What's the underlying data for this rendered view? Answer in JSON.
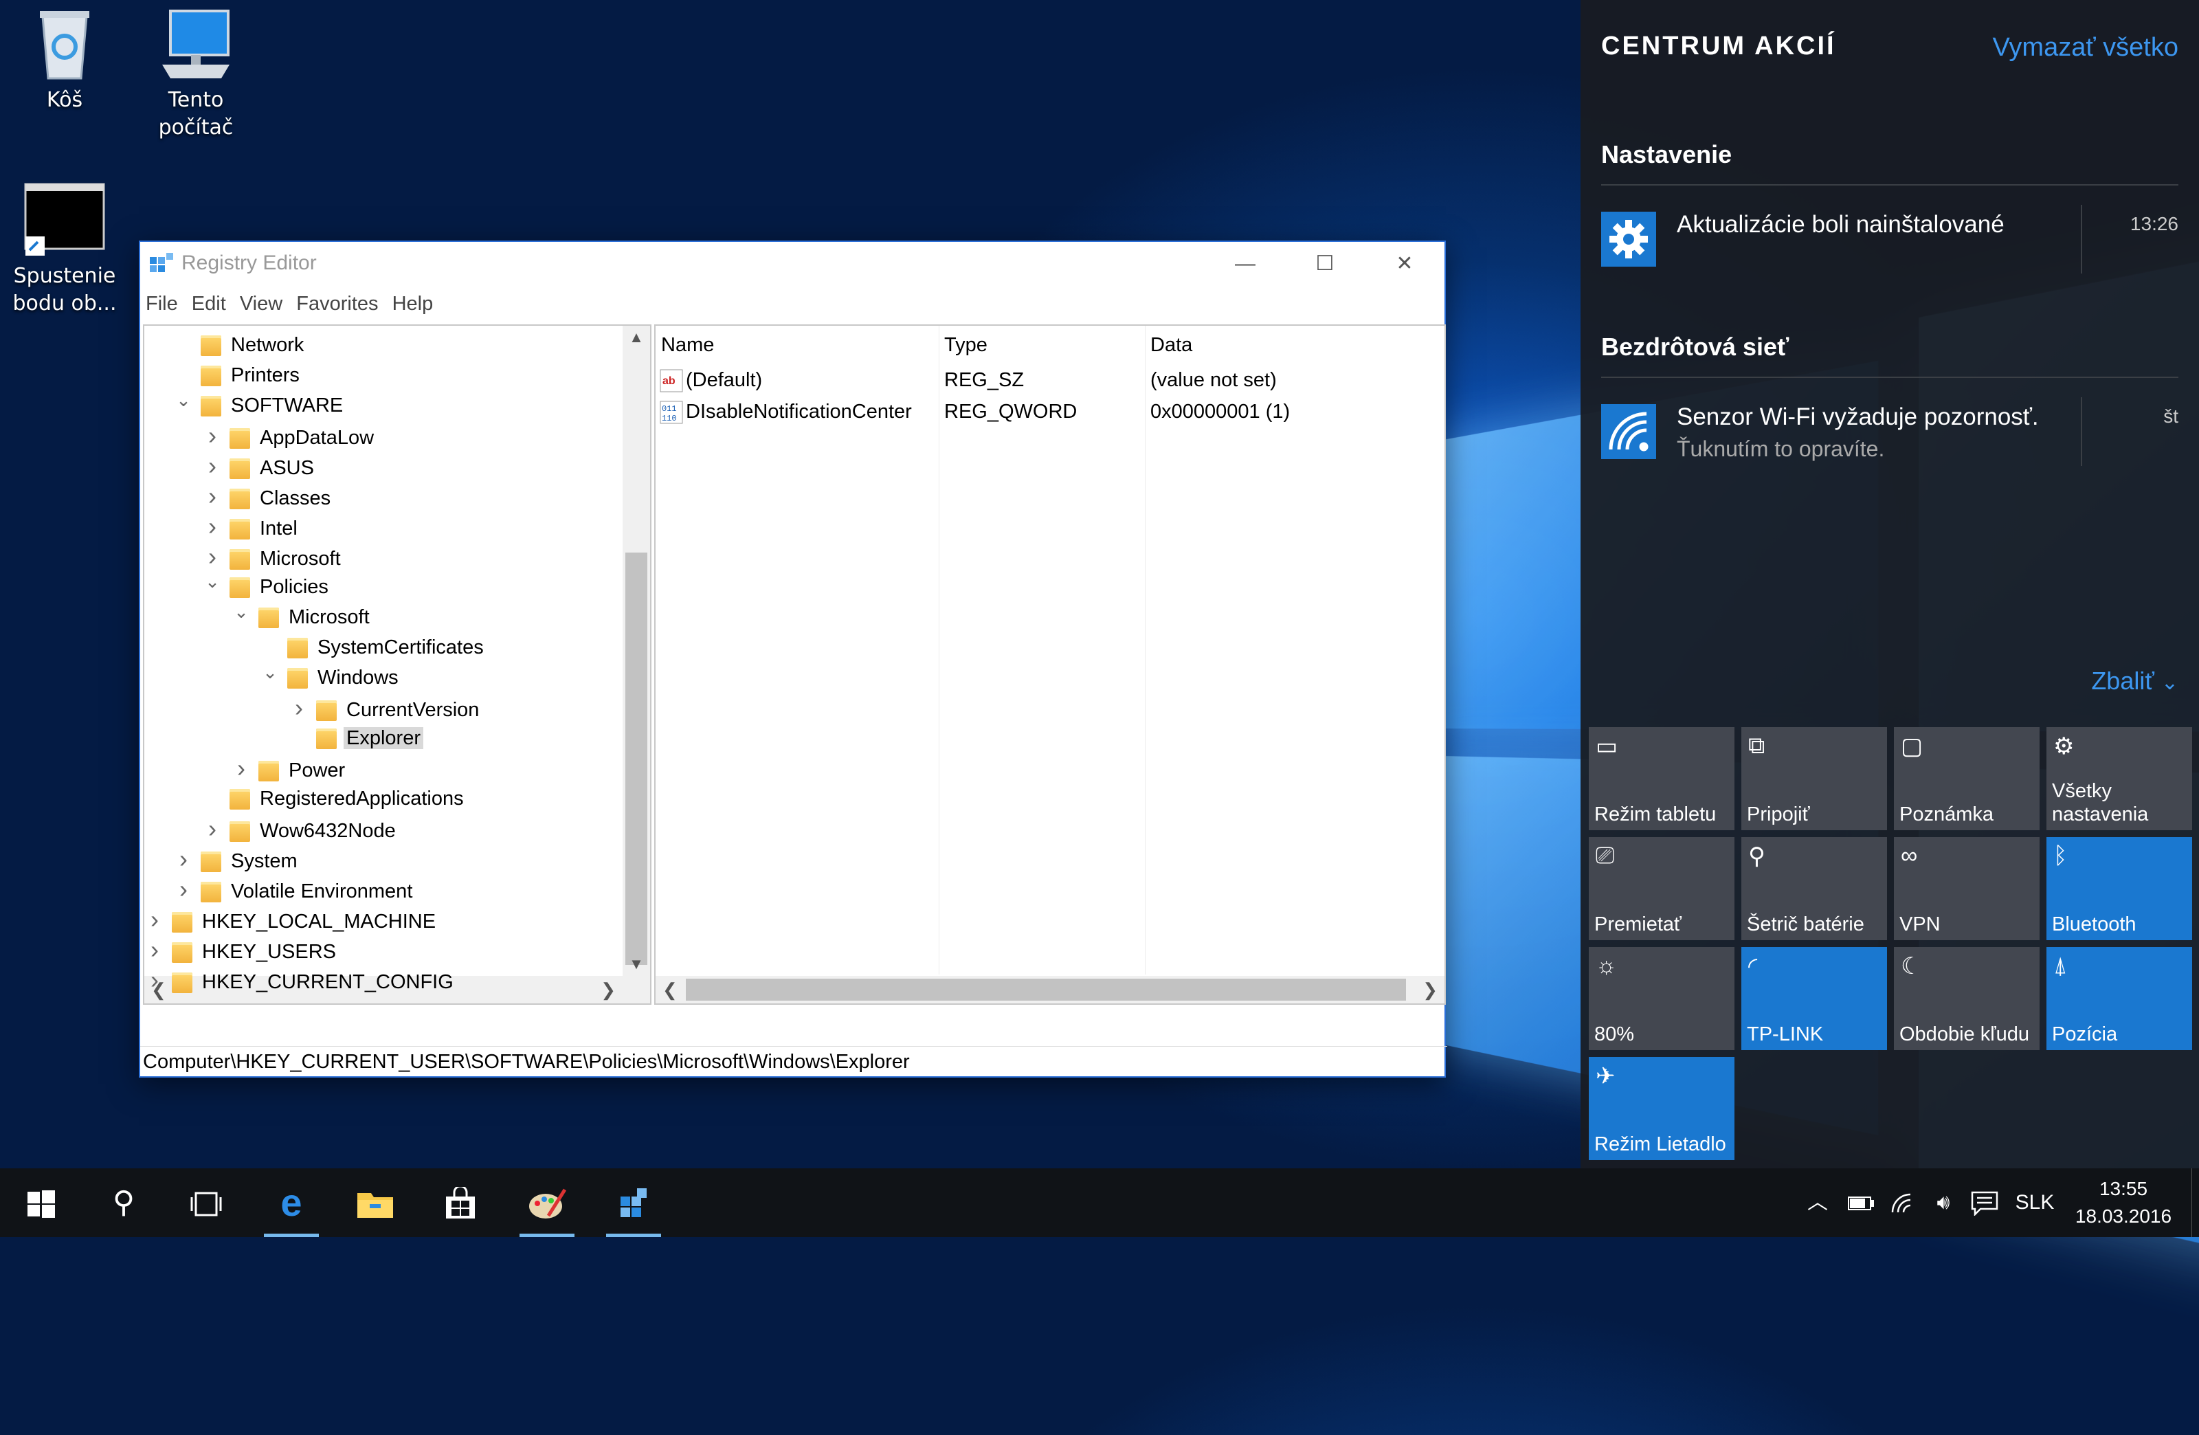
{
  "desktop": {
    "icons": [
      {
        "label": "Kôš"
      },
      {
        "label": "Tento počítač"
      },
      {
        "label": "Spustenie bodu ob..."
      }
    ]
  },
  "registry_editor": {
    "title": "Registry Editor",
    "menu": [
      "File",
      "Edit",
      "View",
      "Favorites",
      "Help"
    ],
    "tree": [
      {
        "label": "Network",
        "level": 2,
        "arrow": ""
      },
      {
        "label": "Printers",
        "level": 2,
        "arrow": ""
      },
      {
        "label": "SOFTWARE",
        "level": 2,
        "arrow": "expanded"
      },
      {
        "label": "AppDataLow",
        "level": 3,
        "arrow": "collapsed"
      },
      {
        "label": "ASUS",
        "level": 3,
        "arrow": "collapsed"
      },
      {
        "label": "Classes",
        "level": 3,
        "arrow": "collapsed"
      },
      {
        "label": "Intel",
        "level": 3,
        "arrow": "collapsed"
      },
      {
        "label": "Microsoft",
        "level": 3,
        "arrow": "collapsed"
      },
      {
        "label": "Policies",
        "level": 3,
        "arrow": "expanded"
      },
      {
        "label": "Microsoft",
        "level": 4,
        "arrow": "expanded"
      },
      {
        "label": "SystemCertificates",
        "level": 5,
        "arrow": ""
      },
      {
        "label": "Windows",
        "level": 5,
        "arrow": "expanded"
      },
      {
        "label": "CurrentVersion",
        "level": 6,
        "arrow": "collapsed"
      },
      {
        "label": "Explorer",
        "level": 6,
        "arrow": "",
        "selected": true
      },
      {
        "label": "Power",
        "level": 4,
        "arrow": "collapsed"
      },
      {
        "label": "RegisteredApplications",
        "level": 3,
        "arrow": ""
      },
      {
        "label": "Wow6432Node",
        "level": 3,
        "arrow": "collapsed"
      },
      {
        "label": "System",
        "level": 2,
        "arrow": "collapsed"
      },
      {
        "label": "Volatile Environment",
        "level": 2,
        "arrow": "collapsed"
      },
      {
        "label": "HKEY_LOCAL_MACHINE",
        "level": 1,
        "arrow": "collapsed"
      },
      {
        "label": "HKEY_USERS",
        "level": 1,
        "arrow": "collapsed"
      },
      {
        "label": "HKEY_CURRENT_CONFIG",
        "level": 1,
        "arrow": "collapsed"
      }
    ],
    "columns": {
      "name": "Name",
      "type": "Type",
      "data": "Data"
    },
    "values": [
      {
        "icon": "string-value-icon",
        "name": "(Default)",
        "type": "REG_SZ",
        "data": "(value not set)"
      },
      {
        "icon": "binary-value-icon",
        "name": "DIsableNotificationCenter",
        "type": "REG_QWORD",
        "data": "0x00000001 (1)"
      }
    ],
    "status_path": "Computer\\HKEY_CURRENT_USER\\SOFTWARE\\Policies\\Microsoft\\Windows\\Explorer"
  },
  "action_center": {
    "title": "CENTRUM AKCIÍ",
    "clear_all": "Vymazať všetko",
    "groups": [
      {
        "header": "Nastavenie",
        "title": "Aktualizácie boli nainštalované",
        "subtitle": "",
        "time": "13:26",
        "icon": "gear-icon"
      },
      {
        "header": "Bezdrôtová sieť",
        "title": "Senzor Wi-Fi vyžaduje pozornosť.",
        "subtitle": "Ťuknutím to opravíte.",
        "time": "št",
        "icon": "wifi-icon"
      }
    ],
    "collapse": "Zbaliť",
    "tiles": [
      {
        "label": "Režim tabletu",
        "icon": "tablet-mode-icon",
        "active": false
      },
      {
        "label": "Pripojiť",
        "icon": "connect-icon",
        "active": false
      },
      {
        "label": "Poznámka",
        "icon": "note-icon",
        "active": false
      },
      {
        "label": "Všetky nastavenia",
        "icon": "settings-icon",
        "active": false
      },
      {
        "label": "Premietať",
        "icon": "project-icon",
        "active": false
      },
      {
        "label": "Šetrič batérie",
        "icon": "battery-saver-icon",
        "active": false
      },
      {
        "label": "VPN",
        "icon": "vpn-icon",
        "active": false
      },
      {
        "label": "Bluetooth",
        "icon": "bluetooth-icon",
        "active": true
      },
      {
        "label": "80%",
        "icon": "brightness-icon",
        "active": false
      },
      {
        "label": "TP-LINK",
        "icon": "wifi-icon",
        "active": true
      },
      {
        "label": "Obdobie kľudu",
        "icon": "quiet-hours-icon",
        "active": false
      },
      {
        "label": "Pozícia",
        "icon": "location-icon",
        "active": true
      },
      {
        "label": "Režim Lietadlo",
        "icon": "airplane-icon",
        "active": true
      }
    ]
  },
  "taskbar": {
    "language": "SLK",
    "time": "13:55",
    "date": "18.03.2016"
  }
}
